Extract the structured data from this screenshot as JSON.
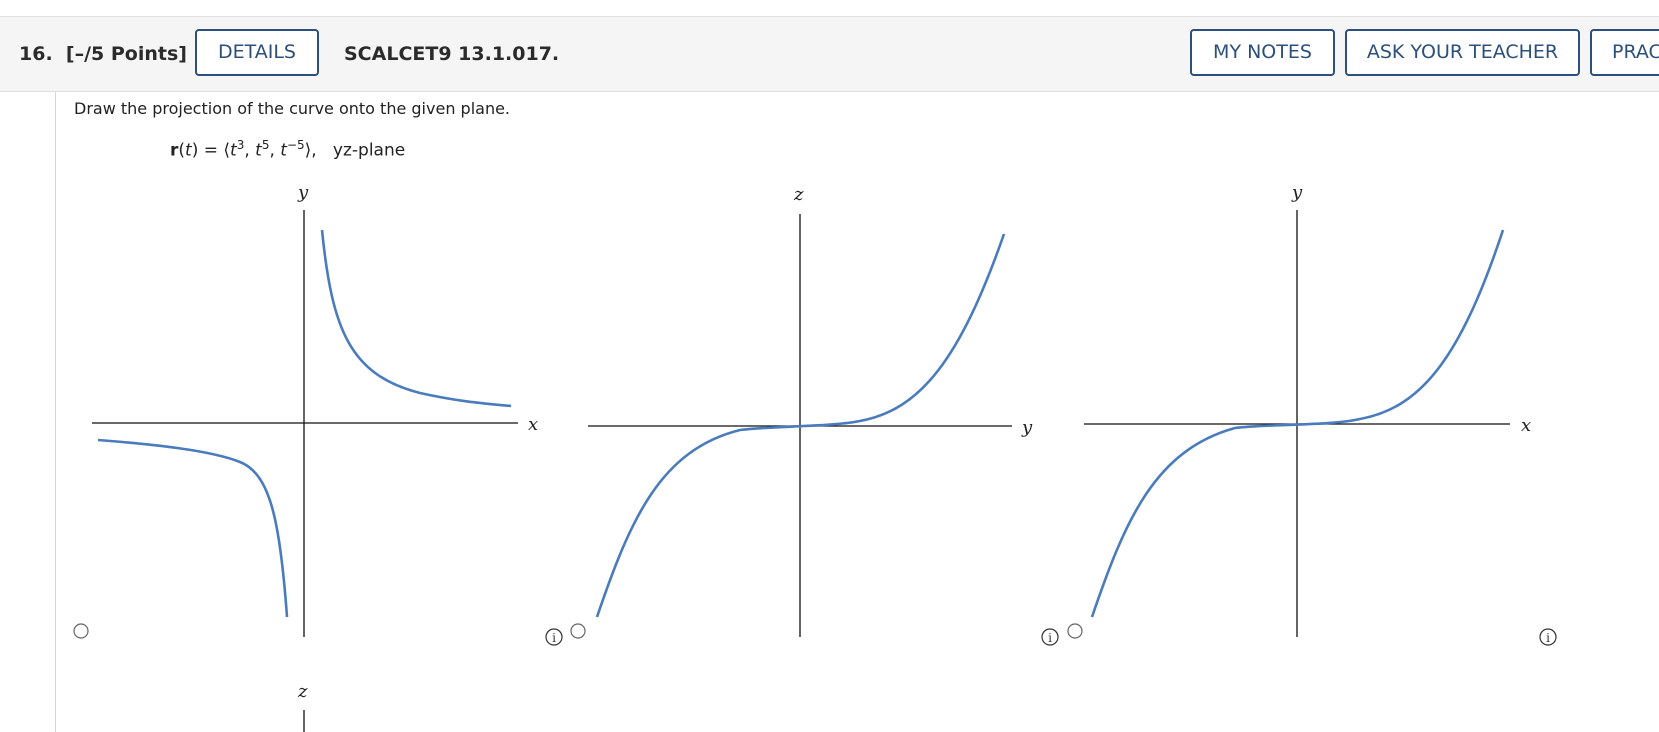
{
  "header": {
    "question_number": "16.",
    "points": "[–/5 Points]",
    "details_label": "DETAILS",
    "reference": "SCALCET9 13.1.017.",
    "my_notes_label": "MY NOTES",
    "ask_teacher_label": "ASK YOUR TEACHER",
    "practice_label": "PRAC"
  },
  "question": {
    "prompt": "Draw the projection of the curve onto the given plane.",
    "formula": {
      "r": "r",
      "t_var": "t",
      "exp1": "3",
      "exp2": "5",
      "exp3": "−5",
      "plane": "yz-plane"
    }
  },
  "graphs": [
    {
      "option": "A",
      "horizontal_axis": "x",
      "vertical_axis": "y",
      "curve": "y = 1/x (hyperbola)",
      "selected": false
    },
    {
      "option": "B",
      "horizontal_axis": "y",
      "vertical_axis": "z",
      "curve": "cubic",
      "selected": false
    },
    {
      "option": "C",
      "horizontal_axis": "x",
      "vertical_axis": "y",
      "curve": "cubic",
      "selected": false
    },
    {
      "option": "D",
      "horizontal_axis": "",
      "vertical_axis": "z",
      "curve": "partial",
      "selected": false
    }
  ],
  "colors": {
    "curve": "#4a7bbd",
    "button_border": "#2d4f7c",
    "header_bg": "#f5f5f5"
  },
  "icons": {
    "info": "info-icon",
    "radio": "radio-button"
  }
}
